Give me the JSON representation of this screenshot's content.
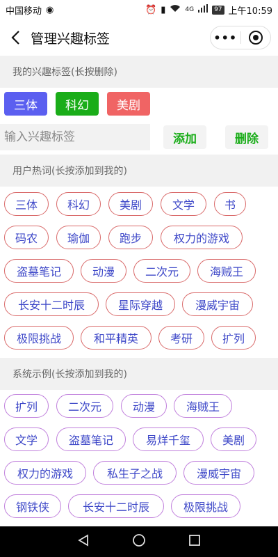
{
  "statusbar": {
    "carrier": "中国移动",
    "signal_text": "4G",
    "battery": "97",
    "time": "上午10:59"
  },
  "navbar": {
    "title": "管理兴趣标签",
    "more_glyph": "•••"
  },
  "my_section": {
    "header": "我的兴趣标签(长按删除)",
    "tags": [
      {
        "label": "三体",
        "color": "#5b5ff0"
      },
      {
        "label": "科幻",
        "color": "#1aad19"
      },
      {
        "label": "美剧",
        "color": "#f06464"
      }
    ]
  },
  "input_row": {
    "placeholder": "输入兴趣标签",
    "add_label": "添加",
    "delete_label": "删除"
  },
  "hot_section": {
    "header": "用户热词(长按添加到我的)",
    "tags": [
      "三体",
      "科幻",
      "美剧",
      "文学",
      "书",
      "码农",
      "瑜伽",
      "跑步",
      "权力的游戏",
      "盗墓笔记",
      "动漫",
      "二次元",
      "海贼王",
      "长安十二时辰",
      "星际穿越",
      "漫威宇宙",
      "极限挑战",
      "和平精英",
      "考研",
      "扩列"
    ]
  },
  "sys_section": {
    "header": "系统示例(长按添加到我的)",
    "tags": [
      "扩列",
      "二次元",
      "动漫",
      "海贼王",
      "文学",
      "盗墓笔记",
      "易烊千玺",
      "美剧",
      "权力的游戏",
      "私生子之战",
      "漫威宇宙",
      "钢铁侠",
      "长安十二时辰",
      "极限挑战"
    ]
  },
  "colors": {
    "hot_border": "#d96a6a",
    "sys_border": "#c07fdc",
    "tag_text": "#3e48c8",
    "action_text": "#1aad19"
  }
}
